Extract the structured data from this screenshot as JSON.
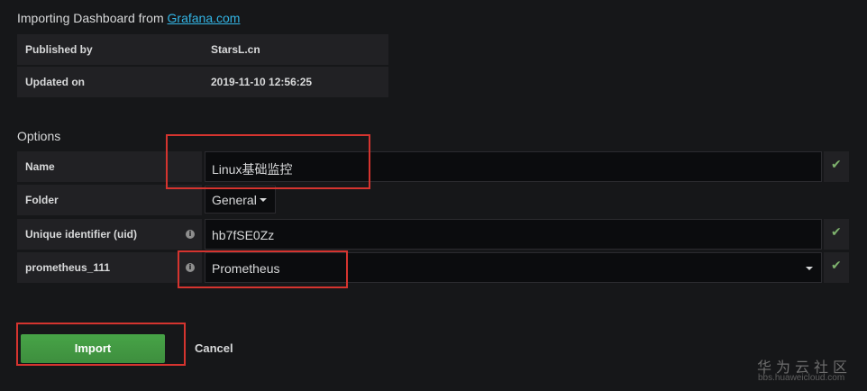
{
  "header": {
    "title_prefix": "Importing Dashboard from ",
    "source_link": "Grafana.com"
  },
  "info": {
    "published_by_label": "Published by",
    "published_by_value": "StarsL.cn",
    "updated_on_label": "Updated on",
    "updated_on_value": "2019-11-10 12:56:25"
  },
  "options": {
    "title": "Options",
    "name_label": "Name",
    "name_value": "Linux基础监控",
    "folder_label": "Folder",
    "folder_value": "General",
    "uid_label": "Unique identifier (uid)",
    "uid_value": "hb7fSE0Zz",
    "datasource_label": "prometheus_111",
    "datasource_value": "Prometheus",
    "check_icon": "✔",
    "info_icon": "i"
  },
  "actions": {
    "import_label": "Import",
    "cancel_label": "Cancel"
  },
  "watermark": {
    "main": "华为云社区",
    "sub": "bbs.huaweicloud.com"
  },
  "colors": {
    "background": "#161719",
    "link": "#33b5e5",
    "success": "#7eb26d",
    "import_button": "#47a447",
    "annotation": "#d5342f"
  }
}
